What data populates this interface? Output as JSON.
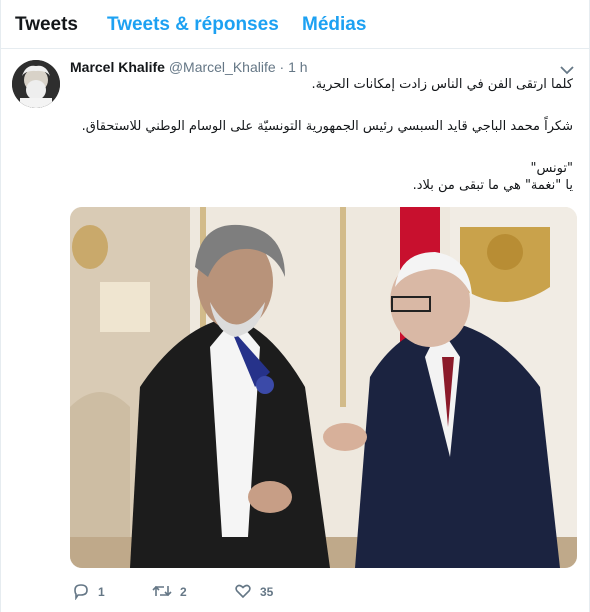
{
  "tabs": [
    {
      "label": "Tweets"
    },
    {
      "label": "Tweets & réponses"
    },
    {
      "label": "Médias"
    }
  ],
  "tweet": {
    "name": "Marcel Khalife",
    "handle": "@Marcel_Khalife",
    "separator": "·",
    "time": "1 h",
    "lines": [
      "كلما ارتقى الفن في الناس زادت إمكانات الحرية.",
      "شكراً محمد الباجي قايد السبسي رئيس الجمهورية التونسيّة على الوسام الوطني للاستحقاق.",
      "\"تونس\"",
      "يا \"نغمة\" هي ما تبقى من بلاد."
    ],
    "actions": {
      "replies": "1",
      "retweets": "2",
      "likes": "35"
    }
  },
  "icons": {
    "reply": "reply-icon",
    "retweet": "retweet-icon",
    "like": "heart-icon",
    "more": "chevron-down-icon"
  },
  "colors": {
    "accent": "#1da1f2",
    "muted": "#657786",
    "text": "#14171a",
    "border": "#e6ecf0"
  }
}
